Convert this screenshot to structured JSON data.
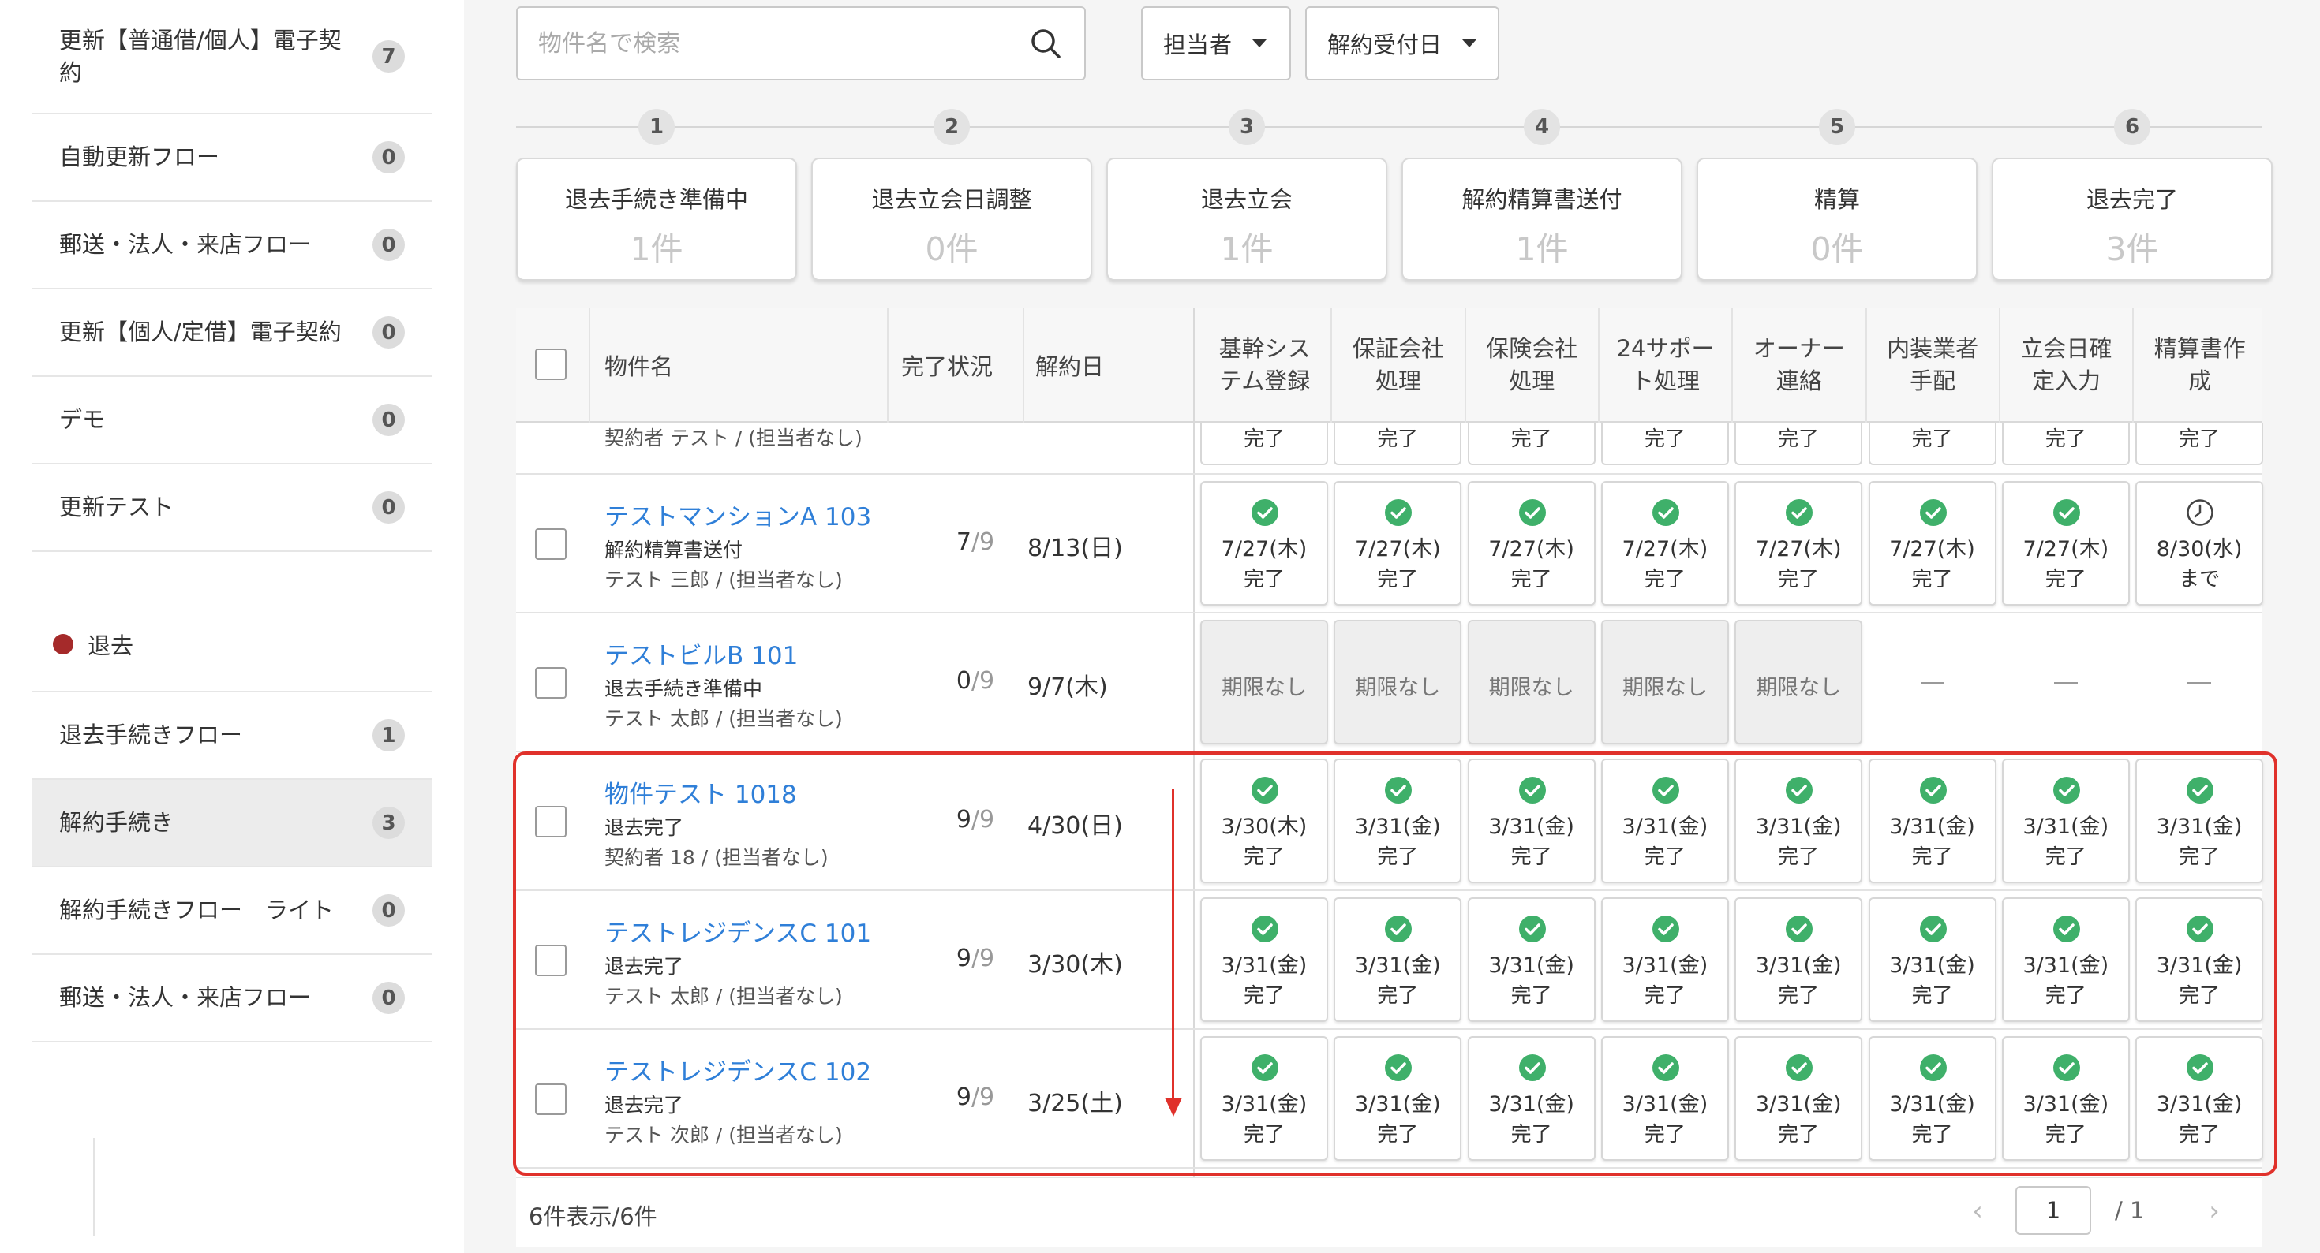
{
  "sidebar": {
    "items_top": [
      {
        "label": "更新【普通借/個人】電子契約",
        "count": "7"
      },
      {
        "label": "自動更新フロー",
        "count": "0"
      },
      {
        "label": "郵送・法人・来店フロー",
        "count": "0"
      },
      {
        "label": "更新【個人/定借】電子契約",
        "count": "0"
      },
      {
        "label": "デモ",
        "count": "0"
      },
      {
        "label": "更新テスト",
        "count": "0"
      }
    ],
    "section": {
      "label": "退去",
      "color": "#a52a2a"
    },
    "items_bottom": [
      {
        "label": "退去手続きフロー",
        "count": "1"
      },
      {
        "label": "解約手続き",
        "count": "3"
      },
      {
        "label": "解約手続きフロー　ライト",
        "count": "0"
      },
      {
        "label": "郵送・法人・来店フロー",
        "count": "0"
      }
    ]
  },
  "toolbar": {
    "search_placeholder": "物件名で検索",
    "filter_assignee": "担当者",
    "filter_date": "解約受付日"
  },
  "steps": [
    {
      "num": "1",
      "title": "退去手続き準備中",
      "count": "1件"
    },
    {
      "num": "2",
      "title": "退去立会日調整",
      "count": "0件"
    },
    {
      "num": "3",
      "title": "退去立会",
      "count": "1件"
    },
    {
      "num": "4",
      "title": "解約精算書送付",
      "count": "1件"
    },
    {
      "num": "5",
      "title": "精算",
      "count": "0件"
    },
    {
      "num": "6",
      "title": "退去完了",
      "count": "3件"
    }
  ],
  "table": {
    "headers": {
      "name": "物件名",
      "progress": "完了状況",
      "date": "解約日",
      "tasks": [
        "基幹シス\nテム登録",
        "保証会社\n処理",
        "保険会社\n処理",
        "24サポー\nト処理",
        "オーナー\n連絡",
        "内装業者\n手配",
        "立会日確\n定入力",
        "精算書作\n成"
      ]
    },
    "partial_row": {
      "owner": "契約者 テスト / (担当者なし)",
      "status": "完了"
    },
    "rows": [
      {
        "name": "テストマンションA  103",
        "status": "解約精算書送付",
        "owner": "テスト 三郎 / (担当者なし)",
        "done": "7",
        "total": "9",
        "date": "8/13(日)",
        "cells": [
          {
            "kind": "done",
            "date": "7/27(木)",
            "label": "完了"
          },
          {
            "kind": "done",
            "date": "7/27(木)",
            "label": "完了"
          },
          {
            "kind": "done",
            "date": "7/27(木)",
            "label": "完了"
          },
          {
            "kind": "done",
            "date": "7/27(木)",
            "label": "完了"
          },
          {
            "kind": "done",
            "date": "7/27(木)",
            "label": "完了"
          },
          {
            "kind": "done",
            "date": "7/27(木)",
            "label": "完了"
          },
          {
            "kind": "done",
            "date": "7/27(木)",
            "label": "完了"
          },
          {
            "kind": "pending",
            "date": "8/30(水)",
            "label": "まで"
          }
        ]
      },
      {
        "name": "テストビルB  101",
        "status": "退去手続き準備中",
        "owner": "テスト 太郎 / (担当者なし)",
        "done": "0",
        "total": "9",
        "date": "9/7(木)",
        "cells": [
          {
            "kind": "nolimit",
            "label": "期限なし"
          },
          {
            "kind": "nolimit",
            "label": "期限なし"
          },
          {
            "kind": "nolimit",
            "label": "期限なし"
          },
          {
            "kind": "nolimit",
            "label": "期限なし"
          },
          {
            "kind": "nolimit",
            "label": "期限なし"
          },
          {
            "kind": "dash"
          },
          {
            "kind": "dash"
          },
          {
            "kind": "dash"
          }
        ]
      },
      {
        "name": "物件テスト  1018",
        "status": "退去完了",
        "owner": "契約者 18 / (担当者なし)",
        "done": "9",
        "total": "9",
        "date": "4/30(日)",
        "cells": [
          {
            "kind": "done",
            "date": "3/30(木)",
            "label": "完了"
          },
          {
            "kind": "done",
            "date": "3/31(金)",
            "label": "完了"
          },
          {
            "kind": "done",
            "date": "3/31(金)",
            "label": "完了"
          },
          {
            "kind": "done",
            "date": "3/31(金)",
            "label": "完了"
          },
          {
            "kind": "done",
            "date": "3/31(金)",
            "label": "完了"
          },
          {
            "kind": "done",
            "date": "3/31(金)",
            "label": "完了"
          },
          {
            "kind": "done",
            "date": "3/31(金)",
            "label": "完了"
          },
          {
            "kind": "done",
            "date": "3/31(金)",
            "label": "完了"
          }
        ]
      },
      {
        "name": "テストレジデンスC  101",
        "status": "退去完了",
        "owner": "テスト 太郎 / (担当者なし)",
        "done": "9",
        "total": "9",
        "date": "3/30(木)",
        "cells": [
          {
            "kind": "done",
            "date": "3/31(金)",
            "label": "完了"
          },
          {
            "kind": "done",
            "date": "3/31(金)",
            "label": "完了"
          },
          {
            "kind": "done",
            "date": "3/31(金)",
            "label": "完了"
          },
          {
            "kind": "done",
            "date": "3/31(金)",
            "label": "完了"
          },
          {
            "kind": "done",
            "date": "3/31(金)",
            "label": "完了"
          },
          {
            "kind": "done",
            "date": "3/31(金)",
            "label": "完了"
          },
          {
            "kind": "done",
            "date": "3/31(金)",
            "label": "完了"
          },
          {
            "kind": "done",
            "date": "3/31(金)",
            "label": "完了"
          }
        ]
      },
      {
        "name": "テストレジデンスC  102",
        "status": "退去完了",
        "owner": "テスト 次郎 / (担当者なし)",
        "done": "9",
        "total": "9",
        "date": "3/25(土)",
        "cells": [
          {
            "kind": "done",
            "date": "3/31(金)",
            "label": "完了"
          },
          {
            "kind": "done",
            "date": "3/31(金)",
            "label": "完了"
          },
          {
            "kind": "done",
            "date": "3/31(金)",
            "label": "完了"
          },
          {
            "kind": "done",
            "date": "3/31(金)",
            "label": "完了"
          },
          {
            "kind": "done",
            "date": "3/31(金)",
            "label": "完了"
          },
          {
            "kind": "done",
            "date": "3/31(金)",
            "label": "完了"
          },
          {
            "kind": "done",
            "date": "3/31(金)",
            "label": "完了"
          },
          {
            "kind": "done",
            "date": "3/31(金)",
            "label": "完了"
          }
        ]
      }
    ]
  },
  "footer": {
    "summary": "6件表示/6件",
    "page_value": "1",
    "page_total": "/ 1"
  },
  "colors": {
    "done_green": "#3fb06a",
    "link_blue": "#2f7fd8",
    "highlight_red": "#e0312b"
  }
}
